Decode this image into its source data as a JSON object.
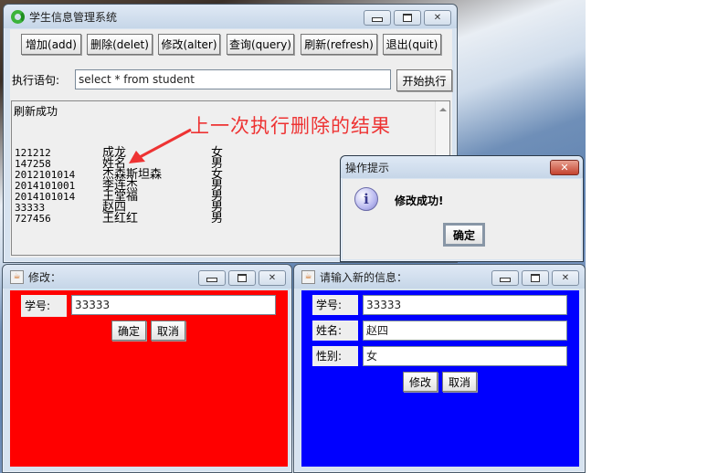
{
  "main_window": {
    "title": "学生信息管理系统",
    "icon": "recycle-app-icon",
    "toolbar": [
      {
        "label": "增加(add)"
      },
      {
        "label": "删除(delet)"
      },
      {
        "label": "修改(alter)"
      },
      {
        "label": "查询(query)"
      },
      {
        "label": "刷新(refresh)"
      },
      {
        "label": "退出(quit)"
      }
    ],
    "sql_label": "执行语句:",
    "sql_value": "select * from student",
    "execute_label": "开始执行",
    "output": {
      "status": "刷新成功",
      "rows": [
        {
          "id": "121212",
          "name": "成龙",
          "gender": "女"
        },
        {
          "id": "147258",
          "name": "姓名",
          "gender": "男"
        },
        {
          "id": "2012101014",
          "name": "杰森斯坦森",
          "gender": "女"
        },
        {
          "id": "2014101001",
          "name": "李连杰",
          "gender": "男"
        },
        {
          "id": "2014101014",
          "name": "王堂福",
          "gender": "男"
        },
        {
          "id": "33333",
          "name": "赵四",
          "gender": "男"
        },
        {
          "id": "727456",
          "name": "王红红",
          "gender": "男"
        }
      ]
    },
    "annotation": "上一次执行删除的结果",
    "annotation_color": "#ee3333"
  },
  "dialog": {
    "title": "操作提示",
    "message": "修改成功!",
    "ok_label": "确定",
    "icon": "info-icon"
  },
  "alter_window": {
    "title": "修改：",
    "bg_color": "#ff0000",
    "id_label": "学号:",
    "id_value": "33333",
    "ok_label": "确定",
    "cancel_label": "取消"
  },
  "info_window": {
    "title": "请输入新的信息：",
    "bg_color": "#0000ff",
    "id_label": "学号:",
    "id_value": "33333",
    "name_label": "姓名:",
    "name_value": "赵四",
    "gender_label": "性别:",
    "gender_value": "女",
    "modify_label": "修改",
    "cancel_label": "取消"
  }
}
